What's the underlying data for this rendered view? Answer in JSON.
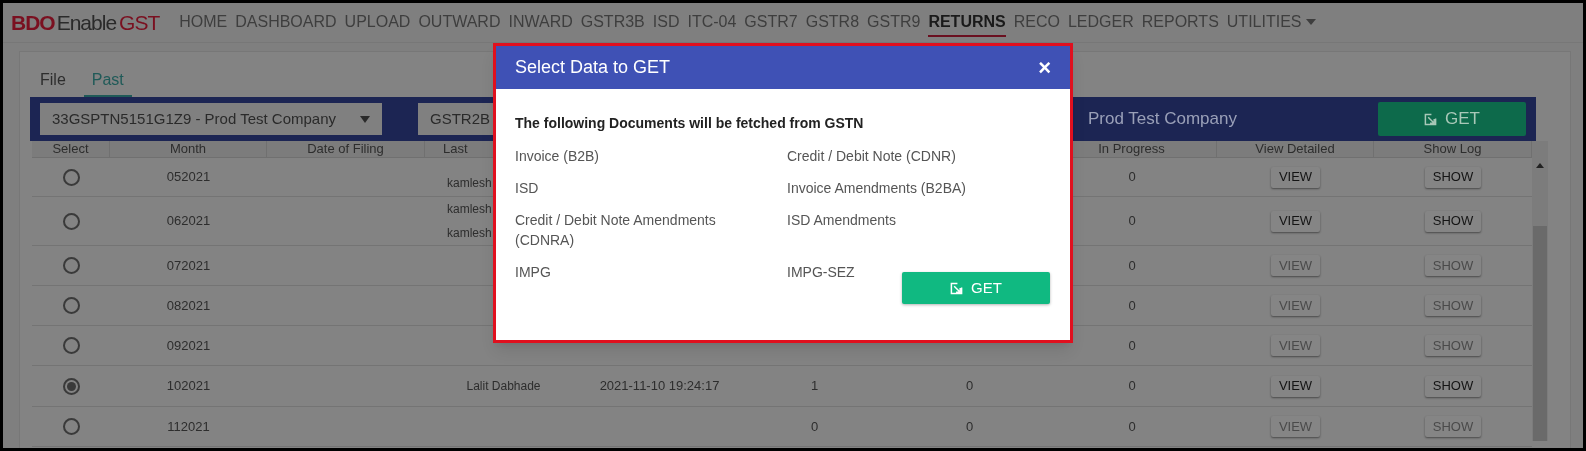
{
  "logo": {
    "part_1": "BDO",
    "part_2": "Enable",
    "part_3": "GST"
  },
  "nav": [
    {
      "label": "HOME",
      "selected": false
    },
    {
      "label": "DASHBOARD",
      "selected": false
    },
    {
      "label": "UPLOAD",
      "selected": false
    },
    {
      "label": "OUTWARD",
      "selected": false
    },
    {
      "label": "INWARD",
      "selected": false
    },
    {
      "label": "GSTR3B",
      "selected": false
    },
    {
      "label": "ISD",
      "selected": false
    },
    {
      "label": "ITC-04",
      "selected": false
    },
    {
      "label": "GSTR7",
      "selected": false
    },
    {
      "label": "GSTR8",
      "selected": false
    },
    {
      "label": "GSTR9",
      "selected": false
    },
    {
      "label": "RETURNS",
      "selected": true
    },
    {
      "label": "RECO",
      "selected": false
    },
    {
      "label": "LEDGER",
      "selected": false
    },
    {
      "label": "REPORTS",
      "selected": false
    },
    {
      "label": "UTILITIES",
      "selected": false,
      "dropdown": true
    }
  ],
  "tabs": [
    {
      "label": "File",
      "selected": false
    },
    {
      "label": "Past",
      "selected": true
    }
  ],
  "filter_bar": {
    "company_select": "33GSPTN5151G1Z9 - Prod Test Company",
    "return_select": "GSTR2B",
    "company_label": "Prod Test Company",
    "get_button": "GET"
  },
  "table": {
    "columns": [
      "Select",
      "Month",
      "Date of Filing",
      "Last",
      "",
      "",
      "",
      "In Progress",
      "View Detailed",
      "Show Log"
    ],
    "rows": [
      {
        "selected": false,
        "month": "052021",
        "filed_by": [
          "kamlesh"
        ],
        "view": {
          "label": "VIEW",
          "disabled": false
        },
        "show": {
          "label": "SHOW",
          "disabled": false
        },
        "in_progress": "0"
      },
      {
        "selected": false,
        "month": "062021",
        "filed_by": [
          "kamlesh",
          "kamlesh"
        ],
        "view": {
          "label": "VIEW",
          "disabled": false
        },
        "show": {
          "label": "SHOW",
          "disabled": false
        },
        "in_progress": "0"
      },
      {
        "selected": false,
        "month": "072021",
        "view": {
          "label": "VIEW",
          "disabled": true
        },
        "show": {
          "label": "SHOW",
          "disabled": true
        },
        "in_progress": "0"
      },
      {
        "selected": false,
        "month": "082021",
        "view": {
          "label": "VIEW",
          "disabled": true
        },
        "show": {
          "label": "SHOW",
          "disabled": true
        },
        "in_progress": "0"
      },
      {
        "selected": false,
        "month": "092021",
        "view": {
          "label": "VIEW",
          "disabled": true
        },
        "show": {
          "label": "SHOW",
          "disabled": true
        },
        "in_progress": "0"
      },
      {
        "selected": true,
        "month": "102021",
        "filed_by": [
          "Lalit Dabhade"
        ],
        "column_5": "2021-11-10 19:24:17",
        "column_6": "1",
        "column_7": "0",
        "view": {
          "label": "VIEW",
          "disabled": false
        },
        "show": {
          "label": "SHOW",
          "disabled": false
        },
        "in_progress": "0"
      },
      {
        "selected": false,
        "month": "112021",
        "column_6": "0",
        "column_7": "0",
        "view": {
          "label": "VIEW",
          "disabled": true
        },
        "show": {
          "label": "SHOW",
          "disabled": true
        },
        "in_progress": "0"
      }
    ]
  },
  "modal": {
    "title": "Select Data to GET",
    "close": "×",
    "heading": "The following Documents will be fetched from GSTN",
    "documents": [
      "Invoice (B2B)",
      "Credit / Debit Note (CDNR)",
      "ISD",
      "Invoice Amendments (B2BA)",
      "Credit / Debit Note Amendments (CDNRA)",
      "ISD Amendments",
      "IMPG",
      "IMPG-SEZ"
    ],
    "get_button": "GET"
  }
}
